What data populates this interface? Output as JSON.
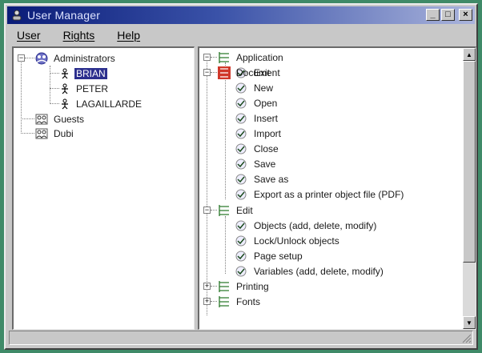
{
  "window": {
    "title": "User Manager",
    "minimize": "_",
    "maximize": "□",
    "close": "×"
  },
  "menu": [
    "User",
    "Rights",
    "Help"
  ],
  "users_tree": {
    "groups": [
      {
        "name": "Administrators",
        "members": [
          "BRIAN",
          "PETER",
          "LAGAILLARDE"
        ],
        "selected": "BRIAN"
      },
      {
        "name": "Guests"
      },
      {
        "name": "Dubi"
      }
    ]
  },
  "rights_tree": [
    {
      "category": "Application",
      "items": [
        "Exit"
      ]
    },
    {
      "category": "Document",
      "items": [
        "New",
        "Open",
        "Insert",
        "Import",
        "Close",
        "Save",
        "Save as",
        "Export as a printer object file (PDF)"
      ]
    },
    {
      "category": "Edit",
      "items": [
        "Objects (add, delete, modify)",
        "Lock/Unlock objects",
        "Page setup",
        "Variables (add, delete, modify)"
      ]
    },
    {
      "category": "Printing",
      "items": []
    },
    {
      "category": "Fonts",
      "items": []
    }
  ],
  "icons": {
    "app": "user-manager-icon",
    "admin_group": "administrators-group-icon",
    "user": "user-icon",
    "group": "group-icon",
    "category": "category-icon",
    "document_category": "document-category-icon",
    "check": "check-icon"
  },
  "colors": {
    "selection": "#2c2f8e",
    "document_icon": "#d0382a",
    "titlebar_start": "#0a1c78"
  }
}
